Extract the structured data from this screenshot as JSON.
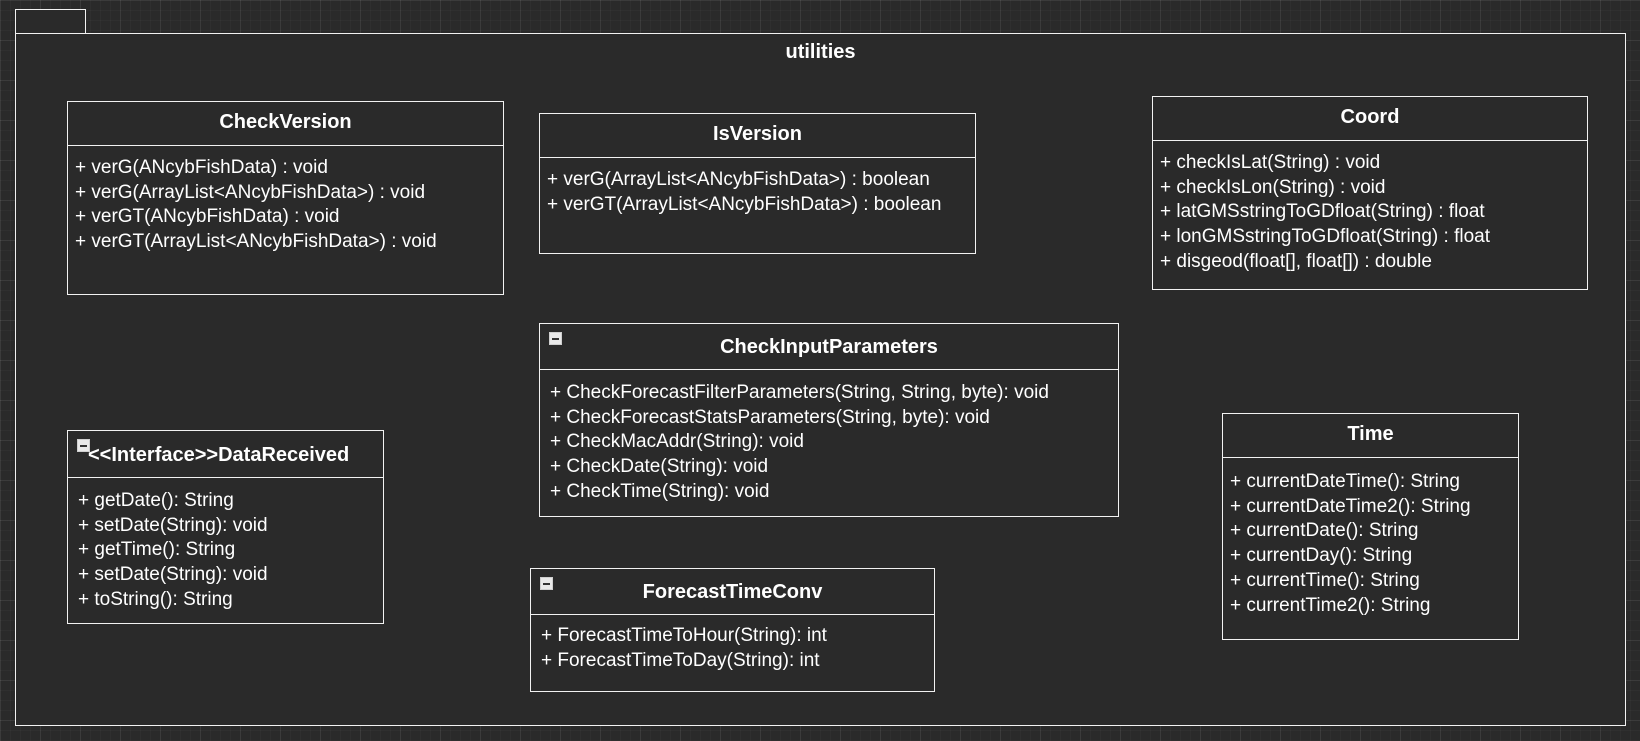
{
  "package": {
    "name": "utilities"
  },
  "classes": {
    "check_version": {
      "name": "CheckVersion",
      "members": [
        "+ verG(ANcybFishData) : void",
        "+ verG(ArrayList<ANcybFishData>) : void",
        "+ verGT(ANcybFishData) : void",
        "+ verGT(ArrayList<ANcybFishData>) : void"
      ]
    },
    "is_version": {
      "name": "IsVersion",
      "members": [
        "+ verG(ArrayList<ANcybFishData>) : boolean",
        "+ verGT(ArrayList<ANcybFishData>) : boolean"
      ]
    },
    "coord": {
      "name": "Coord",
      "members": [
        "+ checkIsLat(String) : void",
        "+ checkIsLon(String) : void",
        "+ latGMSstringToGDfloat(String) : float",
        "+ lonGMSstringToGDfloat(String) : float",
        "+ disgeod(float[], float[]) : double"
      ]
    },
    "check_input_parameters": {
      "name": "CheckInputParameters",
      "members": [
        "+ CheckForecastFilterParameters(String, String, byte): void",
        "+ CheckForecastStatsParameters(String, byte): void",
        "+ CheckMacAddr(String): void",
        "+ CheckDate(String): void",
        "+ CheckTime(String): void"
      ]
    },
    "data_received": {
      "name": "<<Interface>>DataReceived",
      "members": [
        "+ getDate(): String",
        "+ setDate(String): void",
        "+ getTime(): String",
        "+ setDate(String): void",
        "+ toString(): String"
      ]
    },
    "forecast_time_conv": {
      "name": "ForecastTimeConv",
      "members": [
        "+ ForecastTimeToHour(String): int",
        "+ ForecastTimeToDay(String): int"
      ]
    },
    "time": {
      "name": "Time",
      "members": [
        "+ currentDateTime(): String",
        "+ currentDateTime2(): String",
        "+ currentDate(): String",
        "+ currentDay(): String",
        "+ currentTime(): String",
        "+ currentTime2(): String"
      ]
    }
  },
  "colors": {
    "background": "#2a2a2a",
    "stroke": "#f2f2f2",
    "text": "#ffffff"
  },
  "icons": {
    "collapse": "collapse-icon"
  }
}
